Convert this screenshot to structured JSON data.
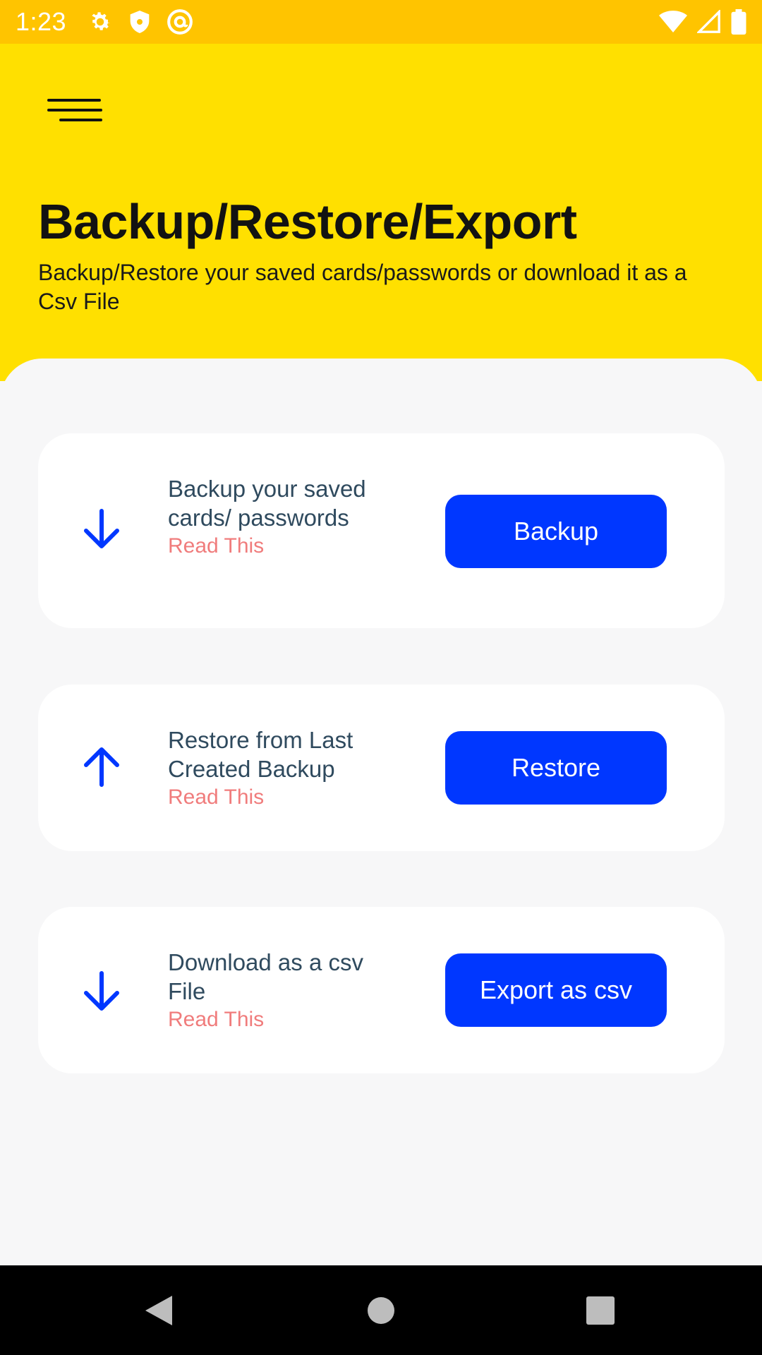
{
  "status_bar": {
    "time": "1:23",
    "left_icons": [
      "settings-icon",
      "shield-icon",
      "at-sign-icon"
    ],
    "right_icons": [
      "wifi-icon",
      "signal-icon",
      "battery-icon"
    ],
    "color": "#FFC400"
  },
  "header": {
    "title": "Backup/Restore/Export",
    "subtitle": "Backup/Restore your saved cards/passwords or download it as a Csv File",
    "background": "#FFE000",
    "menu_icon": "hamburger-menu-icon"
  },
  "cards": [
    {
      "icon": "arrow-down-icon",
      "description": "Backup your saved cards/ passwords",
      "link": "Read This",
      "button": "Backup"
    },
    {
      "icon": "arrow-up-icon",
      "description": "Restore from Last Created Backup",
      "link": "Read This",
      "button": "Restore"
    },
    {
      "icon": "arrow-down-icon",
      "description": "Download as a csv File",
      "link": "Read This",
      "button": "Export as csv"
    }
  ],
  "colors": {
    "accent": "#0037FF",
    "link": "#F07C7C",
    "text": "#2F4A5E"
  },
  "nav_bar": {
    "icons": [
      "back-triangle-icon",
      "home-circle-icon",
      "recents-square-icon"
    ]
  }
}
